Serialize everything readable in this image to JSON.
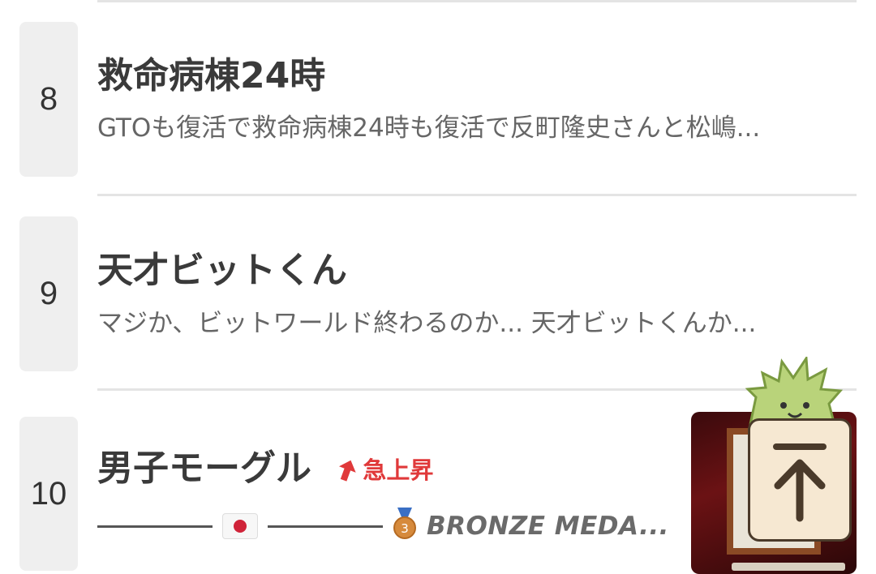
{
  "items": [
    {
      "rank": "8",
      "title": "救命病棟24時",
      "snippet": "GTOも復活で救命病棟24時も復活で反町隆史さんと松嶋..."
    },
    {
      "rank": "9",
      "title": "天才ビットくん",
      "snippet": "マジか、ビットワールド終わるのか... 天才ビットくんか..."
    },
    {
      "rank": "10",
      "title": "男子モーグル",
      "trend_label": "急上昇",
      "snippet": "BRONZE MEDA..."
    }
  ],
  "colors": {
    "trend": "#e0393a",
    "rank_bg": "#efefef",
    "divider": "#e4e4e4"
  },
  "icons": [
    "trend-up-arrow-icon",
    "japan-flag-icon",
    "bronze-medal-icon",
    "scroll-to-top-icon"
  ]
}
